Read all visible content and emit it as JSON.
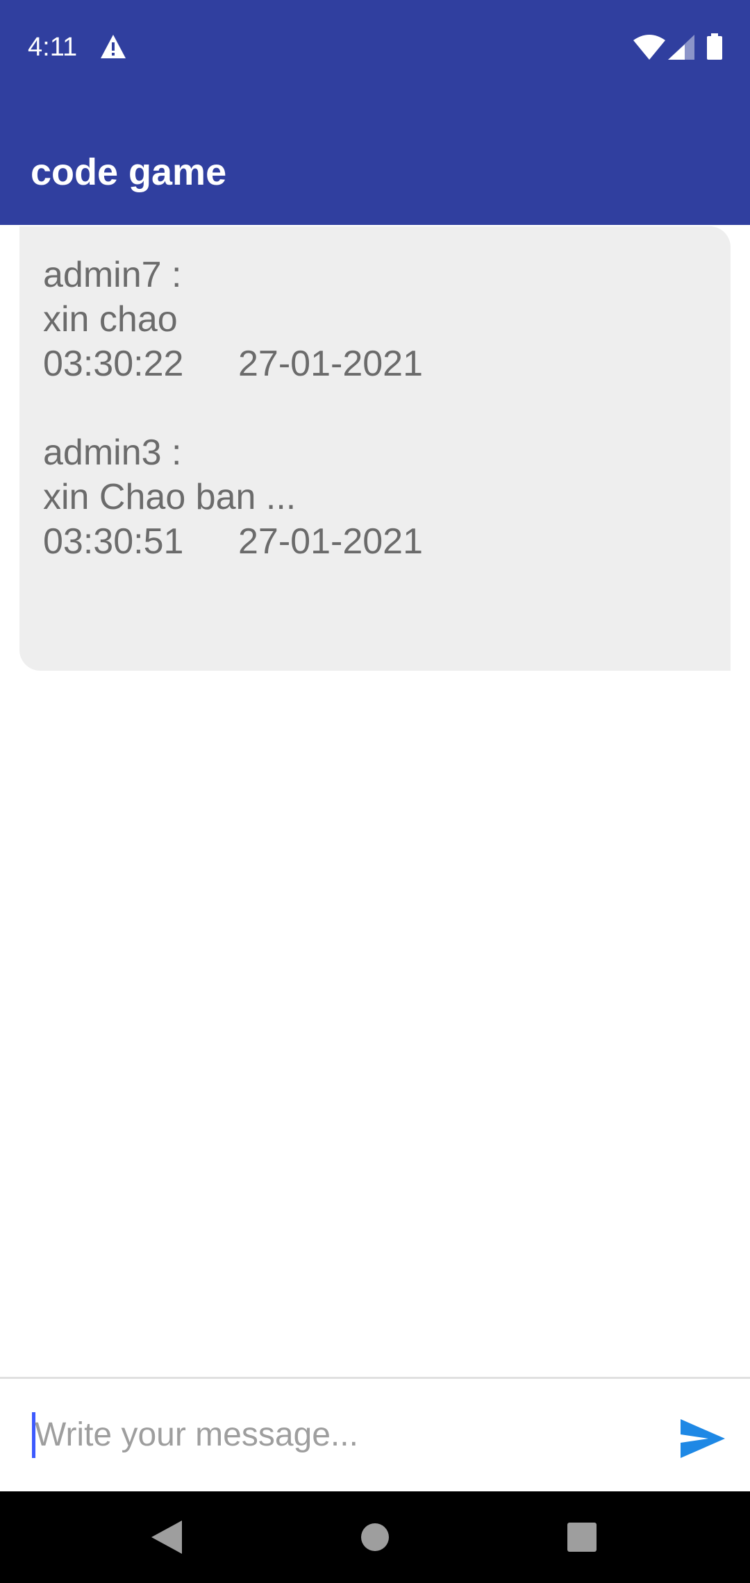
{
  "status_bar": {
    "time": "4:11",
    "icons": [
      "alert-icon",
      "wifi-icon",
      "signal-icon",
      "battery-icon"
    ]
  },
  "app_bar": {
    "title": "code game"
  },
  "messages": [
    {
      "sender": "admin7 :",
      "text": "xin chao",
      "time": "03:30:22",
      "date": "27-01-2021"
    },
    {
      "sender": "admin3 :",
      "text": "xin Chao ban ...",
      "time": "03:30:51",
      "date": "27-01-2021"
    }
  ],
  "composer": {
    "placeholder": "Write your message...",
    "value": "",
    "send_icon": "send-icon"
  },
  "nav_bar": {
    "icons": [
      "back-icon",
      "home-icon",
      "recents-icon"
    ]
  },
  "colors": {
    "primary": "#303f9f",
    "card_background": "#eeeeee",
    "message_text": "#6b6b6b",
    "send_accent": "#1e88e5",
    "cursor": "#3d5afe"
  }
}
